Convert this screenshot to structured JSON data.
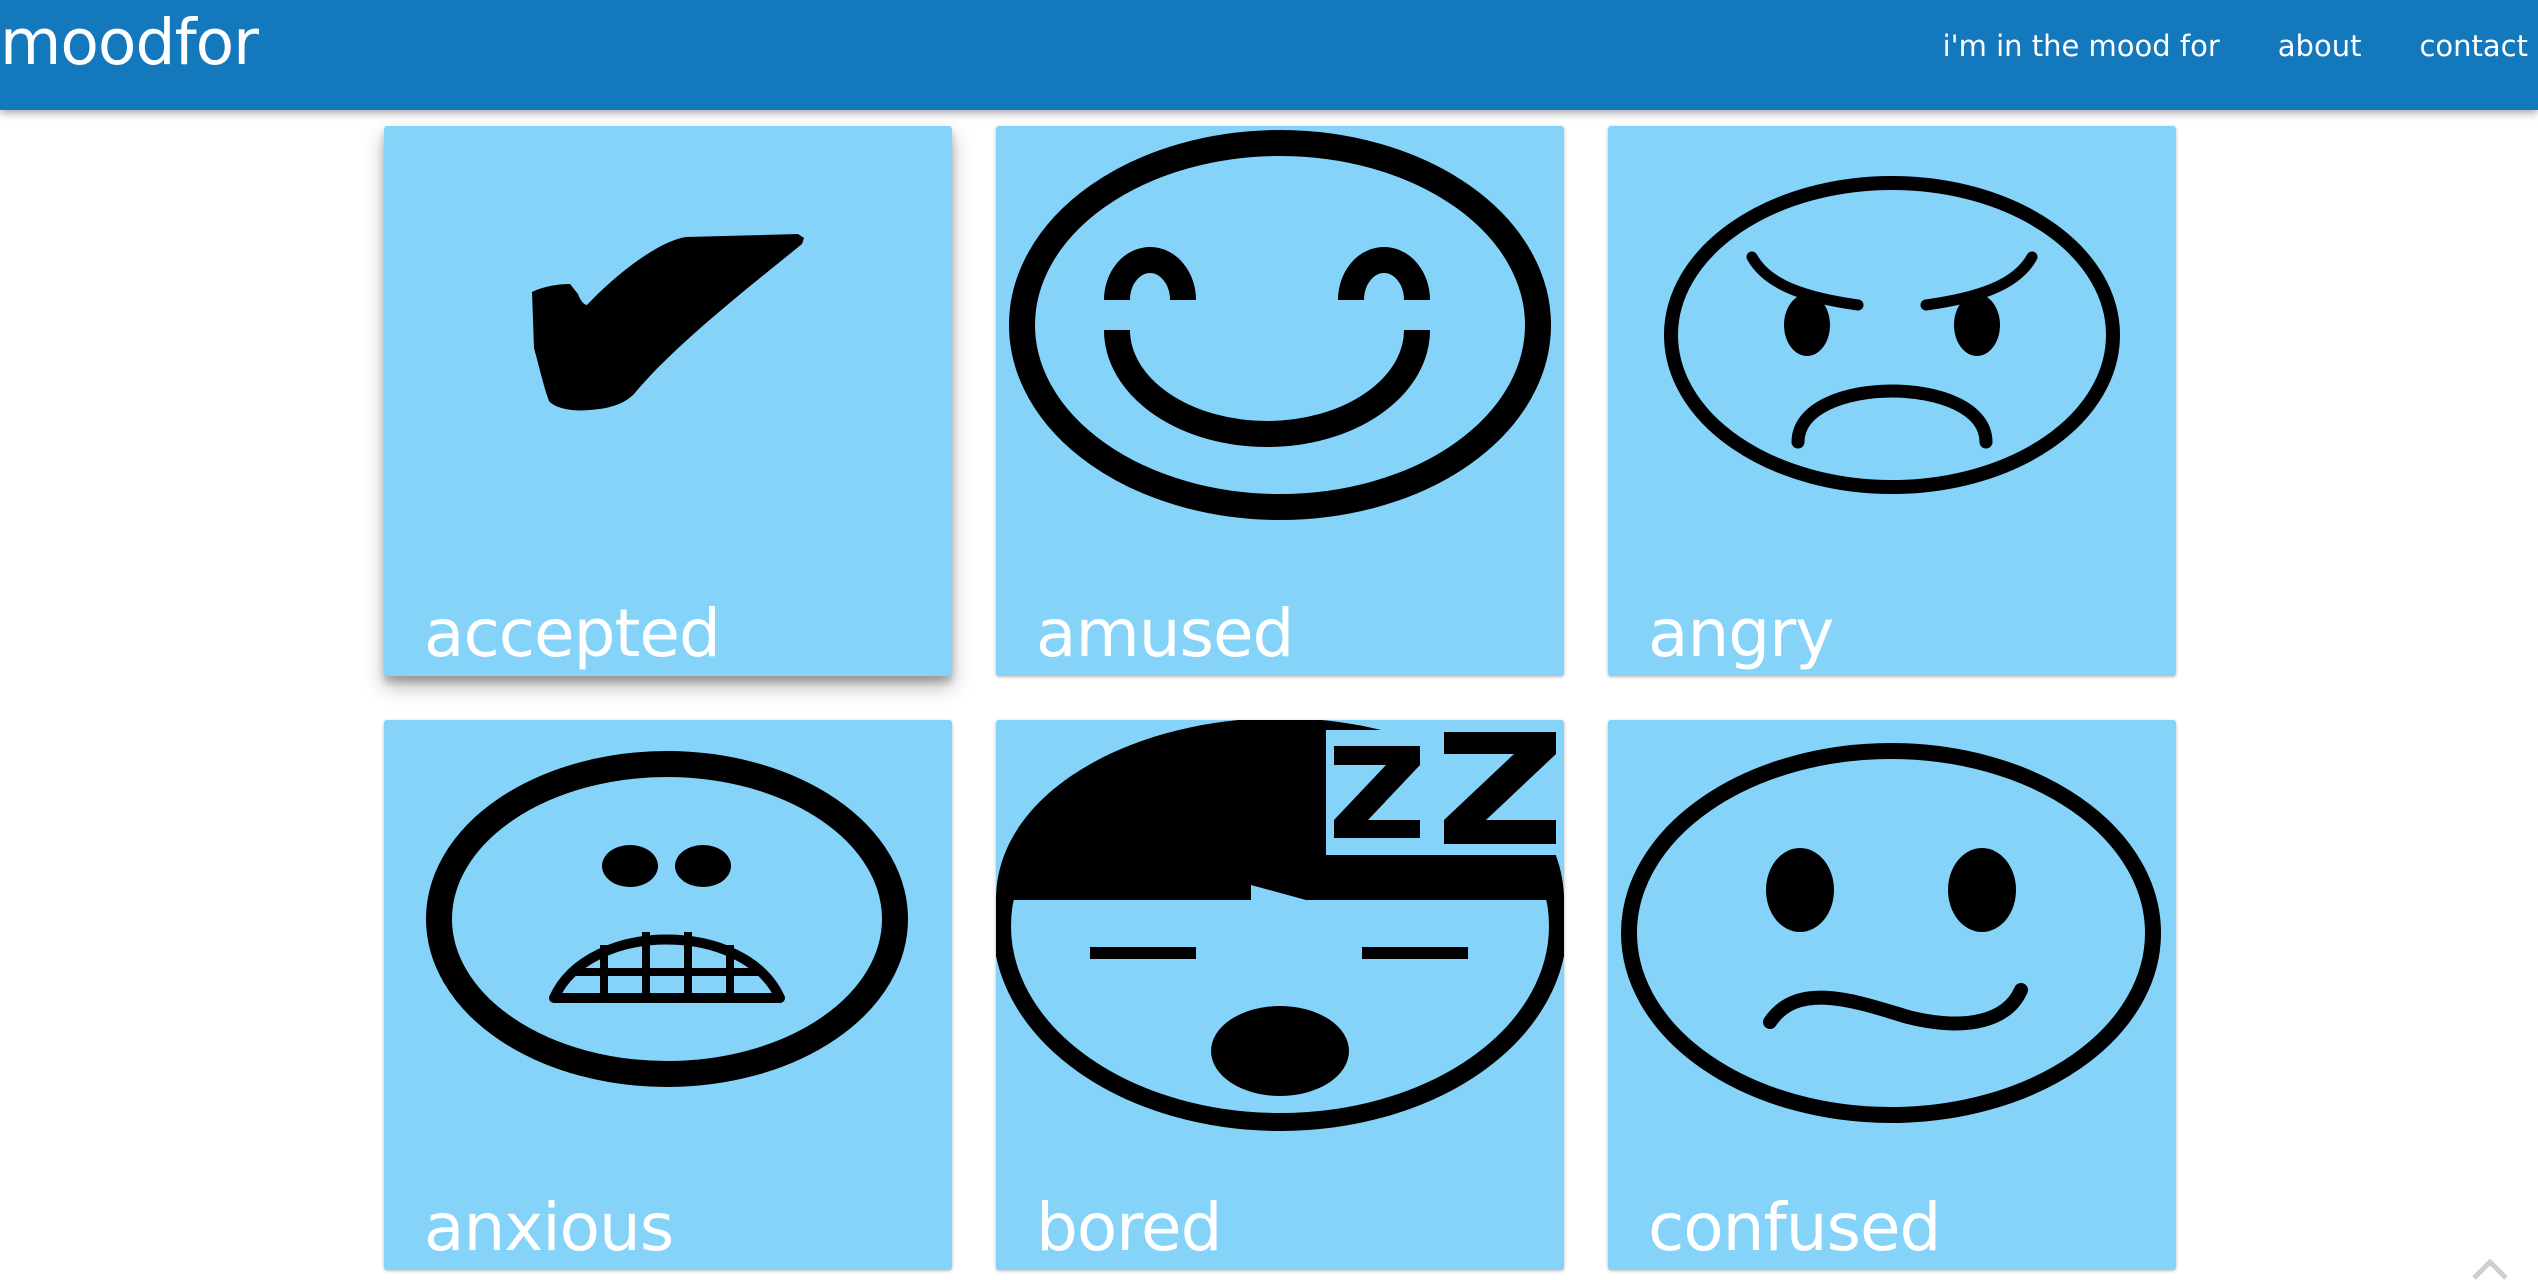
{
  "brand": "moodfor",
  "nav": {
    "mood": "i'm in the mood for",
    "about": "about",
    "contact": "contact"
  },
  "moods": [
    {
      "label": "accepted",
      "icon": "checkmark-icon"
    },
    {
      "label": "amused",
      "icon": "amused-face-icon"
    },
    {
      "label": "angry",
      "icon": "angry-face-icon"
    },
    {
      "label": "anxious",
      "icon": "anxious-face-icon"
    },
    {
      "label": "bored",
      "icon": "bored-face-icon"
    },
    {
      "label": "confused",
      "icon": "confused-face-icon"
    }
  ],
  "colors": {
    "brand": "#1478bd",
    "card": "#85d3f8",
    "icon_ink": "#000000",
    "text": "#ffffff"
  }
}
